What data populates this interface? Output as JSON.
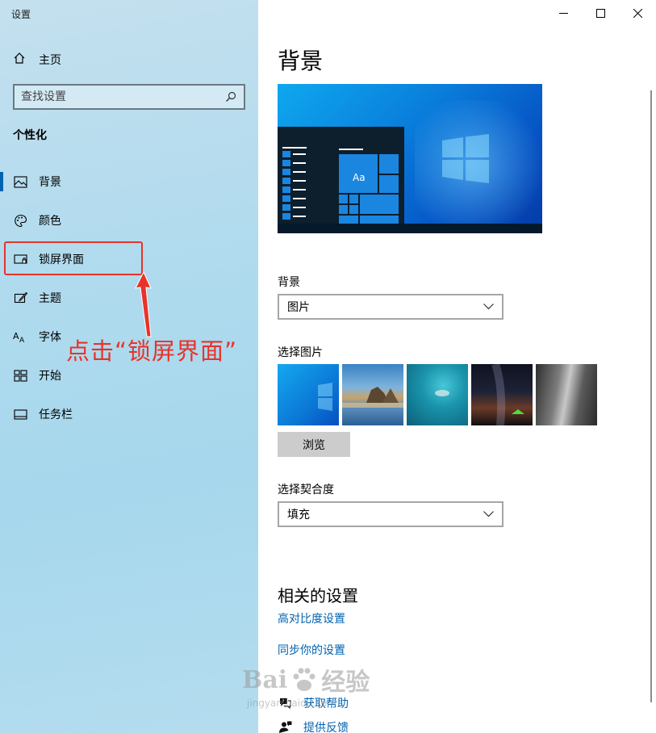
{
  "app": {
    "title": "设置"
  },
  "sidebar": {
    "home_label": "主页",
    "search_placeholder": "查找设置",
    "section_title": "个性化",
    "items": [
      {
        "label": "背景",
        "icon": "image-icon"
      },
      {
        "label": "颜色",
        "icon": "palette-icon"
      },
      {
        "label": "锁屏界面",
        "icon": "lock-screen-icon"
      },
      {
        "label": "主题",
        "icon": "theme-brush-icon"
      },
      {
        "label": "字体",
        "icon": "font-icon"
      },
      {
        "label": "开始",
        "icon": "start-grid-icon"
      },
      {
        "label": "任务栏",
        "icon": "taskbar-icon"
      }
    ],
    "active_index": 0
  },
  "annotation": {
    "text": "点击“锁屏界面”",
    "color": "#e8332a"
  },
  "main": {
    "page_title": "背景",
    "preview": {
      "tile_label": "Aa"
    },
    "background": {
      "label": "背景",
      "value": "图片"
    },
    "choose_picture": {
      "label": "选择图片",
      "browse_label": "浏览"
    },
    "fit": {
      "label": "选择契合度",
      "value": "填充"
    },
    "related": {
      "title": "相关的设置",
      "links": [
        "高对比度设置",
        "同步你的设置"
      ]
    },
    "help": {
      "get_help": "获取帮助",
      "feedback": "提供反馈"
    }
  },
  "watermark": {
    "brand": "Bai",
    "brand_suffix": "经验",
    "url": "jingyan.baidu.com"
  },
  "colors": {
    "accent": "#0063b1",
    "sidebar_bg": "#aed9ed",
    "annotation": "#e8332a"
  }
}
